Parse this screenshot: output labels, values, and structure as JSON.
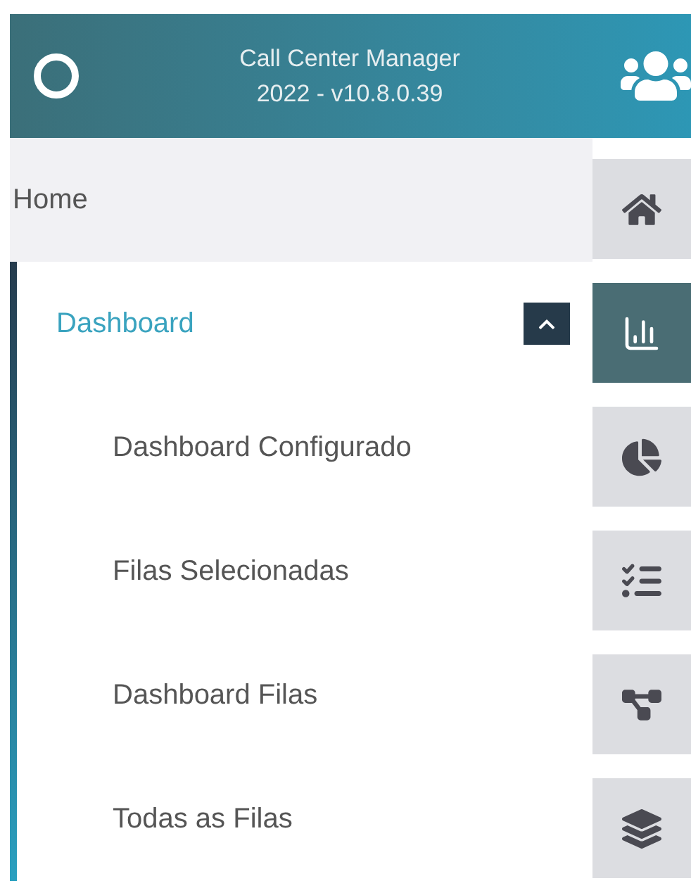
{
  "header": {
    "title": "Call Center Manager",
    "version": "2022 - v10.8.0.39"
  },
  "menu": [
    {
      "label": "Home",
      "selected": false,
      "expanded": false
    },
    {
      "label": "Dashboard",
      "selected": true,
      "expanded": true,
      "children": [
        {
          "label": "Dashboard Configurado"
        },
        {
          "label": "Filas Selecionadas"
        },
        {
          "label": "Dashboard Filas"
        },
        {
          "label": "Todas as Filas"
        }
      ]
    }
  ],
  "rail": [
    {
      "kind": "home",
      "selected": false
    },
    {
      "kind": "chart",
      "selected": true
    },
    {
      "kind": "pie",
      "selected": false
    },
    {
      "kind": "list",
      "selected": false
    },
    {
      "kind": "network",
      "selected": false
    },
    {
      "kind": "layers",
      "selected": false
    }
  ]
}
